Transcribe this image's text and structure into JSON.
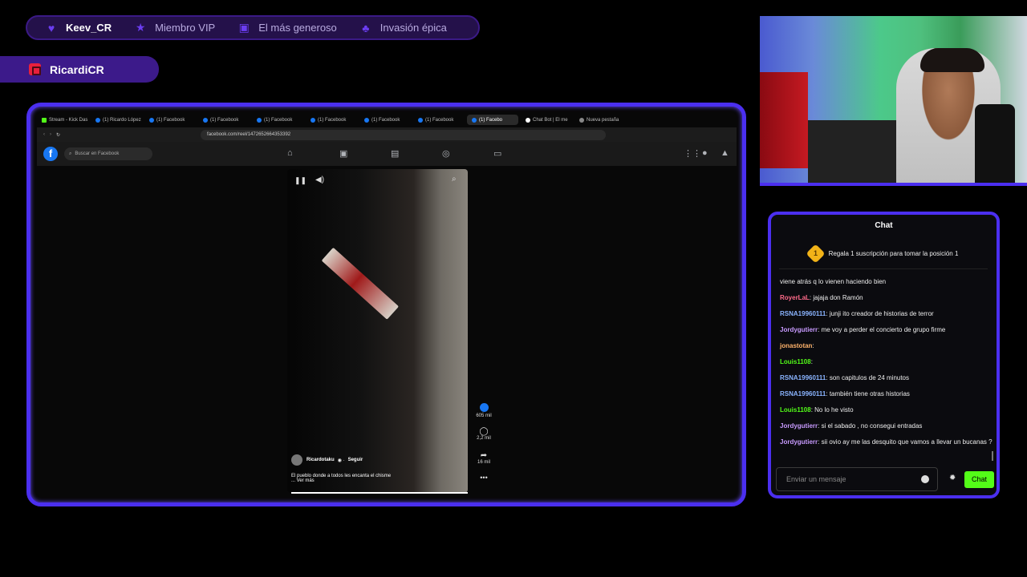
{
  "topbar": {
    "items": [
      {
        "icon": "heart-icon",
        "label": "Keev_CR"
      },
      {
        "icon": "star-icon",
        "label": "Miembro VIP"
      },
      {
        "icon": "gift-icon",
        "label": "El más generoso"
      },
      {
        "icon": "group-icon",
        "label": "Invasión épica"
      }
    ]
  },
  "streamer": {
    "name": "RicardiCR",
    "icon": "kick-icon"
  },
  "browser": {
    "tabs": [
      "Stream - Kick Das",
      "(1) Ricardo López",
      "(1) Facebook",
      "(1) Facebook",
      "(1) Facebook",
      "(1) Facebook",
      "(1) Facebook",
      "(1) Facebook",
      "(1) Facebo",
      "Chat Bot | El me",
      "Nueva pestaña"
    ],
    "url": "facebook.com/reel/1472652664353392",
    "fb_search_placeholder": "Buscar en Facebook",
    "fb_logo": "f",
    "reel": {
      "author": "Ricardotaku",
      "follow": "Seguir",
      "caption": "El pueblo donde a todos les encanta el chisme",
      "more": "... Ver más",
      "likes": "605 mil",
      "comments": "2,2 mil",
      "shares": "16 mil",
      "progress_percent": 100
    }
  },
  "chat": {
    "title": "Chat",
    "pinned": "Regala 1 suscripción para tomar la posición 1",
    "pinned_rank": "1",
    "messages": [
      {
        "user": "",
        "text": "viene atrás q lo vienen haciendo bien",
        "color": "#ffffff"
      },
      {
        "user": "RoyerLaL",
        "text": ": jajaja don Ramón",
        "color": "#ff6b8a"
      },
      {
        "user": "RSNA19960111",
        "text": ": junji ito creador de historias de terror",
        "color": "#8ab4ff"
      },
      {
        "user": "Jordygutierr",
        "text": ": me voy a perder el concierto de grupo firme",
        "color": "#c89bff"
      },
      {
        "user": "jonastotan",
        "text": ":",
        "color": "#ffb36b"
      },
      {
        "user": "Louis1108",
        "text": ":",
        "color": "#53fc18"
      },
      {
        "user": "RSNA19960111",
        "text": ": son capitulos de 24 minutos",
        "color": "#8ab4ff"
      },
      {
        "user": "RSNA19960111",
        "text": ": también tiene otras historias",
        "color": "#8ab4ff"
      },
      {
        "user": "Louis1108",
        "text": ": No lo he visto",
        "color": "#53fc18"
      },
      {
        "user": "Jordygutierr",
        "text": ": si el sabado , no consegui entradas",
        "color": "#c89bff"
      },
      {
        "user": "Jordygutierr",
        "text": ": sii ovio ay me las desquito que vamos a llevar un bucanas ?",
        "color": "#c89bff"
      }
    ],
    "input_placeholder": "Enviar un mensaje",
    "send_label": "Chat"
  }
}
